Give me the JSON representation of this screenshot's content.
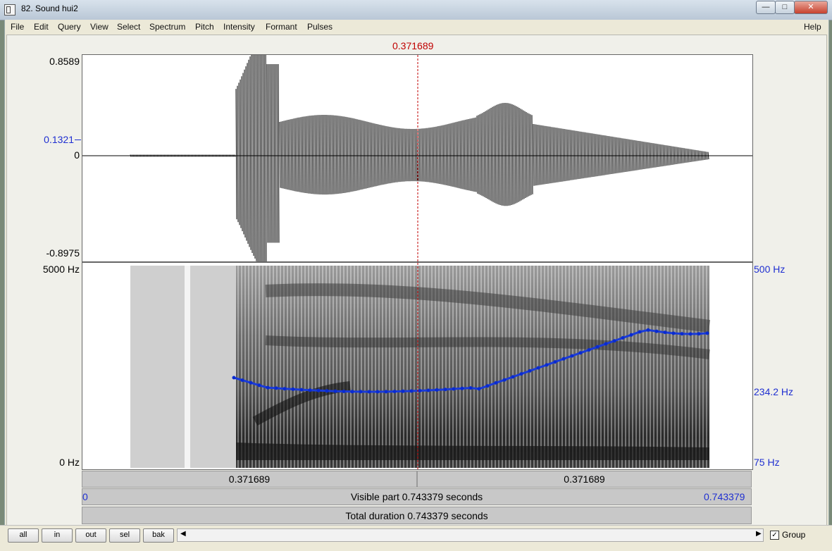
{
  "window": {
    "title": "82. Sound hui2"
  },
  "menu": [
    "File",
    "Edit",
    "Query",
    "View",
    "Select",
    "Spectrum",
    "Pitch",
    "Intensity",
    "Formant",
    "Pulses"
  ],
  "help": "Help",
  "cursor_time": "0.371689",
  "waveform": {
    "ymax": "0.8589",
    "ycursor": "0.1321",
    "yzero": "0",
    "ymin": "-0.8975"
  },
  "spectrogram": {
    "fmax": "5000 Hz",
    "fmin": "0 Hz"
  },
  "pitch": {
    "max": "500 Hz",
    "mid": "234.2 Hz",
    "min": "75 Hz"
  },
  "time_bar": {
    "left": "0.371689",
    "right": "0.371689"
  },
  "visible_bar": {
    "start": "0",
    "label": "Visible part 0.743379 seconds",
    "end": "0.743379"
  },
  "total_bar": {
    "label": "Total duration 0.743379 seconds"
  },
  "buttons": [
    "all",
    "in",
    "out",
    "sel",
    "bak"
  ],
  "group": {
    "label": "Group",
    "checked": true
  },
  "icons": {
    "window": "app-icon",
    "minimize": "minimize-icon",
    "maximize": "maximize-icon",
    "close": "close-icon",
    "check": "check-icon"
  },
  "colors": {
    "cursor": "#c00000",
    "pitch_line": "#1a3bd8",
    "label_blue": "#1f2fd1"
  }
}
